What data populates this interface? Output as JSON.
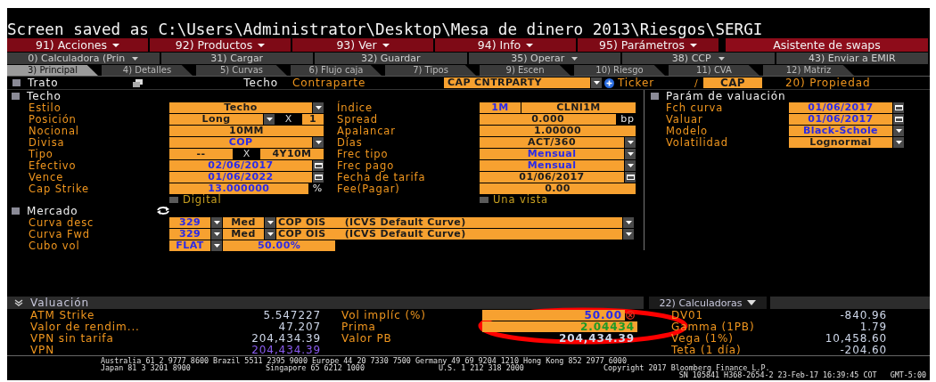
{
  "title": "Screen saved as C:\\Users\\Administrator\\Desktop\\Mesa de dinero 2013\\Riesgos\\SERGI",
  "menu": [
    {
      "label": "91) Acciones",
      "dropdown": true
    },
    {
      "label": "92) Productos",
      "dropdown": true
    },
    {
      "label": "93) Ver",
      "dropdown": true
    },
    {
      "label": "94) Info",
      "dropdown": true
    },
    {
      "label": "95) Parámetros",
      "dropdown": true
    },
    {
      "label": "Asistente de swaps",
      "dropdown": false
    }
  ],
  "toolbar": [
    {
      "label": "0) Calculadora (Prin",
      "dropdown": true
    },
    {
      "label": "31) Cargar",
      "dropdown": false
    },
    {
      "label": "32) Guardar",
      "dropdown": false
    },
    {
      "label": "35) Operar",
      "dropdown": true
    },
    {
      "label": "38) CCP",
      "dropdown": true
    },
    {
      "label": "43) Enviar a EMIR",
      "dropdown": false
    }
  ],
  "tabs": [
    {
      "label": "3) Principal",
      "selected": true
    },
    {
      "label": "4) Detalles",
      "selected": false
    },
    {
      "label": "5) Curvas",
      "selected": false
    },
    {
      "label": "6) Flujo caja",
      "selected": false
    },
    {
      "label": "7) Tipos",
      "selected": false
    },
    {
      "label": "9) Escen",
      "selected": false
    },
    {
      "label": "10) Riesgo",
      "selected": false
    },
    {
      "label": "11) CVA",
      "selected": false
    },
    {
      "label": "12) Matriz",
      "selected": false
    }
  ],
  "deal": {
    "label": "Trato",
    "type": "Techo",
    "counterparty_label": "Contraparte",
    "counterparty": "CAP CNTRPARTY",
    "ticker_label": "Ticker",
    "separator": "/",
    "ticker": "CAP",
    "property": "20) Propiedad"
  },
  "cap": {
    "title": "Techo",
    "rows": [
      {
        "label": "Estilo",
        "controls": [
          {
            "kind": "field",
            "value": "Techo",
            "overridden": false
          },
          {
            "kind": "dropdown"
          }
        ],
        "label2": "Índice",
        "controls2": [
          {
            "kind": "short",
            "value": "1M",
            "overridden": true
          },
          {
            "kind": "field",
            "value": "CLNI1M",
            "overridden": false
          }
        ]
      },
      {
        "label": "Posición",
        "controls": [
          {
            "kind": "field",
            "value": "Long",
            "overridden": false
          },
          {
            "kind": "dropdown"
          },
          {
            "kind": "times",
            "value": "X"
          },
          {
            "kind": "tiny",
            "value": "1",
            "overridden": false
          }
        ],
        "label2": "Spread",
        "controls2": [
          {
            "kind": "field",
            "value": "0.000",
            "overridden": false
          },
          {
            "kind": "unit",
            "value": "bp"
          }
        ]
      },
      {
        "label": "Nocional",
        "controls": [
          {
            "kind": "field",
            "value": "10MM",
            "overridden": false
          }
        ],
        "label2": "Apalancar",
        "controls2": [
          {
            "kind": "field",
            "value": "1.00000",
            "overridden": false
          }
        ]
      },
      {
        "label": "Divisa",
        "controls": [
          {
            "kind": "field",
            "value": "COP",
            "overridden": true
          },
          {
            "kind": "dropdown"
          }
        ],
        "label2": "Días",
        "controls2": [
          {
            "kind": "field",
            "value": "ACT/360",
            "overridden": false
          },
          {
            "kind": "dropdown"
          }
        ]
      },
      {
        "label": "Tipo",
        "controls": [
          {
            "kind": "field",
            "value": "--",
            "overridden": false
          },
          {
            "kind": "times",
            "value": "X"
          },
          {
            "kind": "field",
            "value": "4Y10M",
            "overridden": false
          }
        ],
        "label2": "Frec tipo",
        "controls2": [
          {
            "kind": "field",
            "value": "Mensual",
            "overridden": true
          },
          {
            "kind": "dropdown"
          }
        ]
      },
      {
        "label": "Efectivo",
        "controls": [
          {
            "kind": "field",
            "value": "02/06/2017",
            "overridden": true
          },
          {
            "kind": "calendar"
          }
        ],
        "label2": "Frec pago",
        "controls2": [
          {
            "kind": "field",
            "value": "Mensual",
            "overridden": true
          },
          {
            "kind": "dropdown"
          }
        ]
      },
      {
        "label": "Vence",
        "controls": [
          {
            "kind": "field",
            "value": "01/06/2022",
            "overridden": true
          },
          {
            "kind": "calendar"
          }
        ],
        "label2": "Fecha de tarifa",
        "controls2": [
          {
            "kind": "field",
            "value": "01/06/2017",
            "overridden": false
          },
          {
            "kind": "calendar"
          }
        ]
      },
      {
        "label": "Cap Strike",
        "controls": [
          {
            "kind": "field",
            "value": "13.000000",
            "overridden": true
          },
          {
            "kind": "unit",
            "value": "%"
          }
        ],
        "label2": "Fee(Pagar)",
        "controls2": [
          {
            "kind": "field",
            "value": "0.00",
            "overridden": false
          }
        ]
      }
    ],
    "checks": [
      {
        "label": "Digital",
        "checked": false
      },
      {
        "label": "Una vista",
        "checked": false
      }
    ]
  },
  "market": {
    "title": "Mercado",
    "rows": [
      {
        "label": "Curva desc",
        "controls": [
          {
            "kind": "short",
            "value": "329",
            "overridden": true
          },
          {
            "kind": "dropdown"
          },
          {
            "kind": "short",
            "value": "Med",
            "overridden": false
          },
          {
            "kind": "dropdown"
          },
          {
            "kind": "curve",
            "value": "COP OIS     (ICVS Default Curve)",
            "overridden": false
          },
          {
            "kind": "dropdown"
          }
        ]
      },
      {
        "label": "Curva Fwd",
        "controls": [
          {
            "kind": "short",
            "value": "329",
            "overridden": true
          },
          {
            "kind": "dropdown"
          },
          {
            "kind": "short",
            "value": "Med",
            "overridden": false
          },
          {
            "kind": "dropdown"
          },
          {
            "kind": "curve",
            "value": "COP OIS     (ICVS Default Curve)",
            "overridden": false
          },
          {
            "kind": "dropdown"
          }
        ]
      },
      {
        "label": "Cubo vol",
        "controls": [
          {
            "kind": "short",
            "value": "FLAT",
            "overridden": true
          },
          {
            "kind": "dropdown"
          },
          {
            "kind": "medium",
            "value": "50.00%",
            "overridden": true
          }
        ]
      }
    ]
  },
  "valuation_params": {
    "title": "Parám de valuación",
    "rows": [
      {
        "label": "Fch curva",
        "controls": [
          {
            "kind": "field",
            "value": "01/06/2017",
            "overridden": true
          },
          {
            "kind": "calendar"
          }
        ]
      },
      {
        "label": "Valuar",
        "controls": [
          {
            "kind": "field",
            "value": "01/06/2017",
            "overridden": true
          },
          {
            "kind": "calendar"
          }
        ]
      },
      {
        "label": "Modelo",
        "controls": [
          {
            "kind": "field",
            "value": "Black-Schole",
            "overridden": true
          },
          {
            "kind": "dropdown"
          }
        ]
      },
      {
        "label": "Volatilidad",
        "controls": [
          {
            "kind": "field",
            "value": "Lognormal",
            "overridden": false
          },
          {
            "kind": "dropdown"
          }
        ]
      }
    ]
  },
  "valuation": {
    "title": "Valuación",
    "calculators": "22) Calculadoras",
    "rows": [
      {
        "label": "ATM Strike",
        "value": "5.547227",
        "color": "#cfd8ea",
        "label2": "Vol implíc (%)",
        "field2": {
          "kind": "field",
          "value": "50.00",
          "overridden": true,
          "clear": true
        },
        "label3": "DV01",
        "value3": "-840.96"
      },
      {
        "label": "Valor de rendim...",
        "value": "47.207",
        "color": "#cfd8ea",
        "label2": "Prima",
        "field2": {
          "kind": "field",
          "value": "2.04434",
          "overridden": false,
          "clear": false
        },
        "label3": "Gamma (1PB)",
        "value3": "1.79"
      },
      {
        "label": "VPN sin tarifa",
        "value": "204,434.39",
        "color": "#cfd8ea",
        "label2": "Valor PB",
        "field2": {
          "kind": "text",
          "value": "204,434.39",
          "color": "#cfd8ea",
          "clear": false
        },
        "label3": "Vega (1%)",
        "value3": "10,458.60"
      },
      {
        "label": "VPN",
        "value": "204,434.39",
        "color": "#8a5cf0",
        "label3": "Teta (1 día)",
        "value3": "-204.60"
      }
    ]
  },
  "highlight_ellipse": true,
  "footer": {
    "line1": "Australia 61 2 9777 8600 Brazil 5511 2395 9000 Europe 44 20 7330 7500 Germany 49 69 9204 1210 Hong Kong 852 2977 6000",
    "line2": [
      "Japan 81 3 3201 8900",
      "Singapore 65 6212 1000",
      "U.S. 1 212 318 2000",
      "Copyright 2017 Bloomberg Finance L.P."
    ],
    "line3": "SN 105841 H368-2654-2 23-Feb-17 16:39:45 COT   GMT-5:00"
  }
}
